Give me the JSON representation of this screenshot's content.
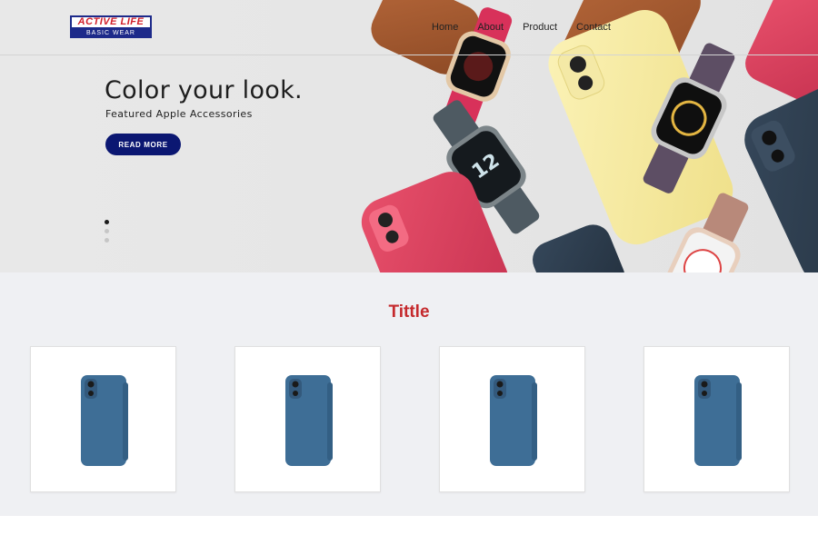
{
  "brand": {
    "logo_top": "ACTIVE LIFE",
    "logo_bottom": "BASIC WEAR",
    "brand_colors": {
      "navy": "#1d2a8a",
      "red": "#d11f2a"
    }
  },
  "nav": {
    "items": [
      {
        "label": "Home"
      },
      {
        "label": "About"
      },
      {
        "label": "Product"
      },
      {
        "label": "Contact"
      }
    ]
  },
  "hero": {
    "title": "Color your look.",
    "subtitle": "Featured Apple Accessories",
    "cta_label": "READ MORE",
    "cta_color": "#0b1772",
    "slides_total": 3,
    "active_slide": 1
  },
  "products": {
    "title": "Tittle",
    "title_color": "#c52a2d",
    "card_count": 4,
    "product_icon": "blue-phone-folio-case-icon",
    "product_color": "#3e6e96"
  }
}
